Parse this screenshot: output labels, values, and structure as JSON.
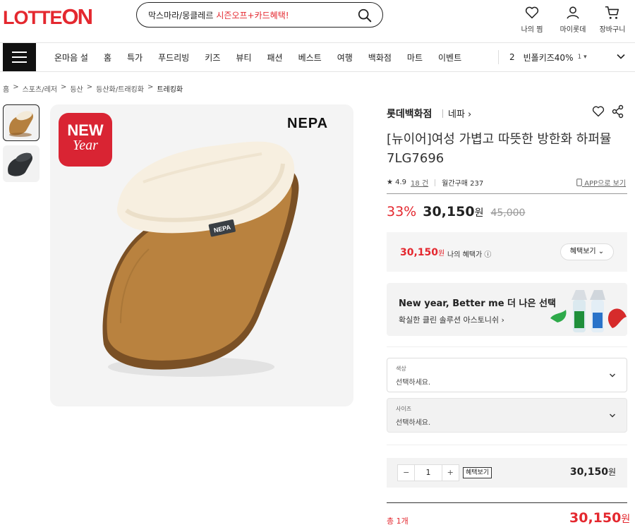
{
  "header": {
    "logo_a": "LOTTE",
    "logo_b": "ON",
    "search_text_a": "막스마라/몽클레르 ",
    "search_text_b": "시즌오프+카드혜택!",
    "wishlist_label": "나의 찜",
    "mylotte_label": "마이롯데",
    "cart_label": "장바구니"
  },
  "nav": {
    "items": [
      "온마음 설",
      "홈",
      "특가",
      "푸드리빙",
      "키즈",
      "뷰티",
      "패션",
      "베스트",
      "여행",
      "백화점",
      "마트",
      "이벤트"
    ],
    "trend_rank": "2",
    "trend_text": "빈폴키즈40%",
    "trend_change": "1 ▾"
  },
  "breadcrumb": [
    "홈",
    ">",
    "스포츠/레저",
    ">",
    "등산",
    ">",
    "등산화/트래킹화",
    ">",
    "트레킹화"
  ],
  "gallery": {
    "badge_line1": "NEW",
    "badge_line2": "Year",
    "brand_mark": "NEPA",
    "tag_text": "NEPA"
  },
  "product": {
    "seller": "롯데백화점",
    "brand": "네파 ›",
    "title": "[뉴이어]여성 가볍고 따뜻한 방한화 하퍼뮬 7LG7696",
    "rating": "★ 4.9",
    "reviews": "18 건",
    "monthly": "월간구매 237",
    "app_view": "APP으로 보기",
    "discount": "33%",
    "price": "30,150",
    "won": "원",
    "original_price": "45,000"
  },
  "benefit": {
    "price": "30,150",
    "won": "원",
    "label": "나의 혜택가 ⓘ",
    "button": "혜택보기 ⌄"
  },
  "banner": {
    "headline": "New year, Better me 더 나은 선택",
    "sub": "확실한 클린 솔루션 아스토니쉬 ›"
  },
  "options": {
    "color_label": "색상",
    "color_value": "선택하세요.",
    "size_label": "사이즈",
    "size_value": "선택하세요."
  },
  "quantity": {
    "minus": "−",
    "value": "1",
    "plus": "+",
    "benefit_label": "혜택보기",
    "price": "30,150",
    "won": "원"
  },
  "total": {
    "label": "총 1개",
    "price": "30,150",
    "won": "원"
  }
}
